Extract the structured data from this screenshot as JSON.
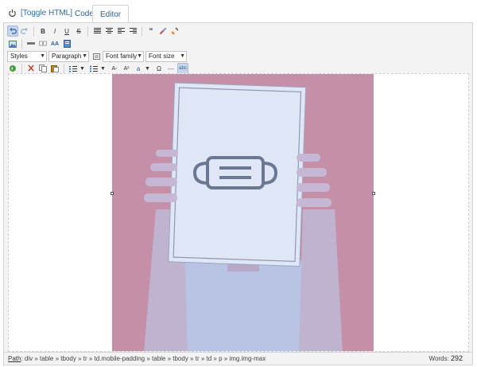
{
  "header": {
    "toggle_label": "[Toggle HTML]",
    "tabs": [
      {
        "label": "Code"
      },
      {
        "label": "Editor",
        "active": true
      }
    ]
  },
  "toolbar": {
    "row1": [
      {
        "icon": "undo-icon"
      },
      {
        "icon": "redo-icon"
      },
      {
        "icon": "bold-icon",
        "glyph": "B"
      },
      {
        "icon": "italic-icon",
        "glyph": "I"
      },
      {
        "icon": "underline-icon",
        "glyph": "U"
      },
      {
        "icon": "strikethrough-icon",
        "glyph": "S"
      },
      {
        "icon": "align-justify-icon"
      },
      {
        "icon": "align-center-icon"
      },
      {
        "icon": "align-left-icon"
      },
      {
        "icon": "align-right-icon"
      },
      {
        "icon": "blockquote-icon",
        "glyph": "“"
      },
      {
        "icon": "unlink-icon"
      },
      {
        "icon": "clean-icon"
      }
    ],
    "row2": [
      {
        "icon": "image-icon"
      },
      {
        "icon": "horizontal-rule-icon"
      },
      {
        "icon": "anchor-icon"
      },
      {
        "icon": "replace-icon",
        "glyph": "AA"
      },
      {
        "icon": "paste-word-icon"
      }
    ],
    "selects": {
      "styles": "Styles",
      "paragraph": "Paragraph",
      "font_family": "Font family",
      "font_size": "Font size"
    },
    "row4": [
      {
        "icon": "preview-icon"
      },
      {
        "icon": "cut-icon"
      },
      {
        "icon": "copy-icon"
      },
      {
        "icon": "paste-icon"
      },
      {
        "icon": "ordered-list-icon"
      },
      {
        "icon": "unordered-list-icon"
      },
      {
        "icon": "font-smaller-icon",
        "glyph": "A-"
      },
      {
        "icon": "superscript-icon",
        "glyph": "A²"
      },
      {
        "icon": "text-color-icon",
        "glyph": "a"
      },
      {
        "icon": "omega-icon",
        "glyph": "Ω"
      },
      {
        "icon": "hr-icon",
        "glyph": "—"
      },
      {
        "icon": "spellcheck-icon",
        "glyph": "abc"
      }
    ]
  },
  "editor": {
    "image_alt": "Person holding a sheet of paper with a face mask icon in front of their face"
  },
  "status": {
    "path_label": "Path",
    "path": ": div » table » tbody » tr » td.mobile-padding » table » tbody » tr » td » p » img.img-max",
    "words_label": "Words:",
    "words_count": "292"
  },
  "colors": {
    "link": "#2b6cb8",
    "photo_bg": "#c58fa8",
    "paper": "#dfe7f7",
    "mask_icon": "#6b7894"
  }
}
